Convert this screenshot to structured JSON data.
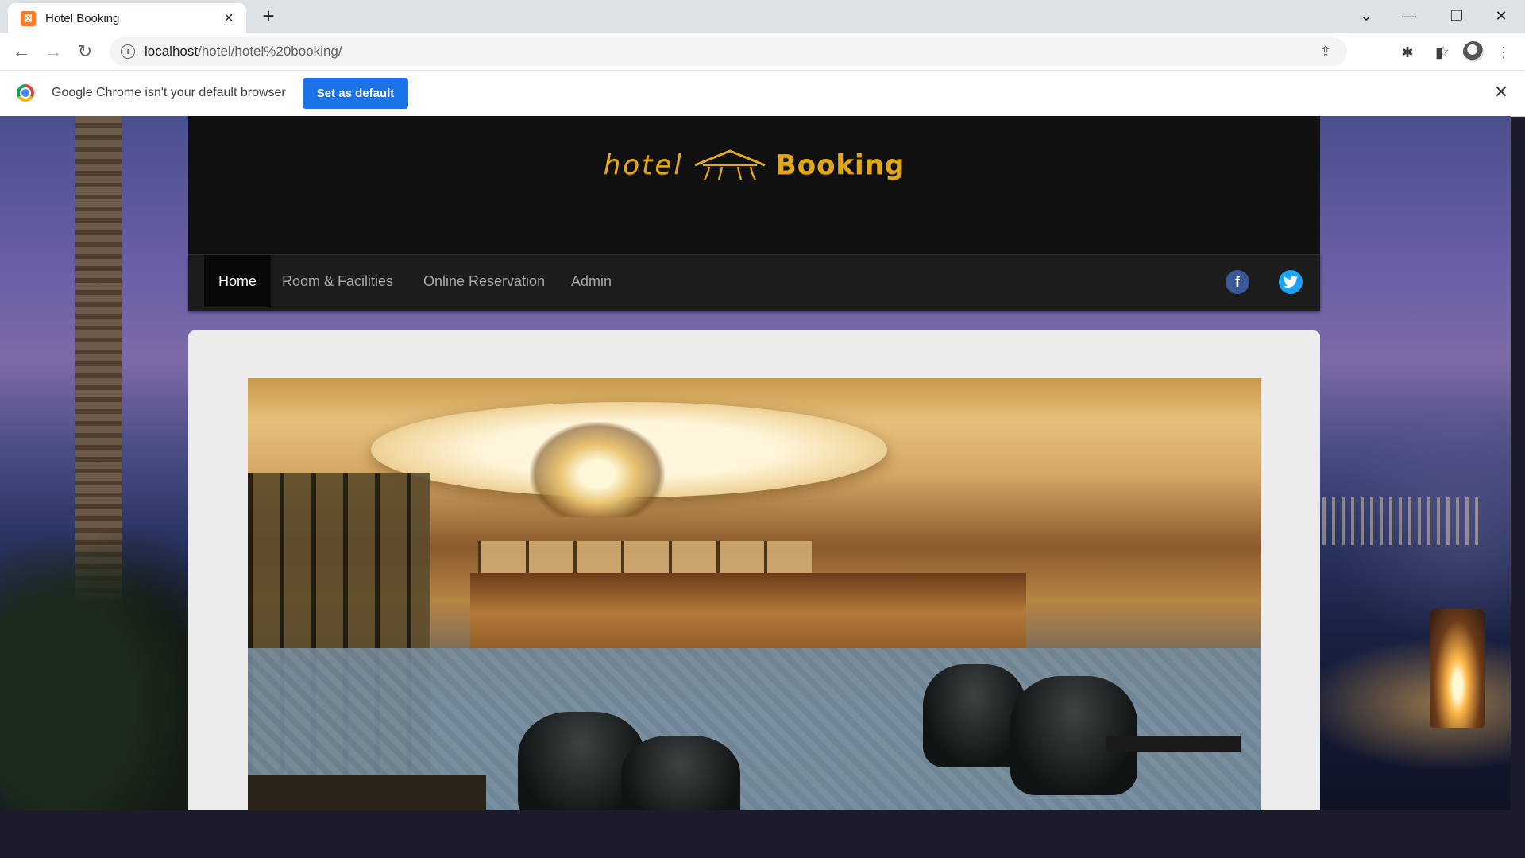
{
  "browser": {
    "tab_title": "Hotel Booking",
    "tab_favicon_letter": "⊠",
    "url_host": "localhost",
    "url_path": "/hotel/hotel%20booking/",
    "infobar_text": "Google Chrome isn't your default browser",
    "infobar_button": "Set as default"
  },
  "site": {
    "logo_left": "hotel",
    "logo_right": "Booking",
    "nav": [
      {
        "label": "Home",
        "active": true
      },
      {
        "label": "Room & Facilities",
        "active": false
      },
      {
        "label": "Online Reservation",
        "active": false
      },
      {
        "label": "Admin",
        "active": false
      }
    ],
    "social": [
      {
        "name": "facebook-icon",
        "glyph": "f",
        "color": "#3b5998"
      },
      {
        "name": "twitter-icon",
        "glyph": "t",
        "color": "#1da1f2"
      }
    ]
  },
  "colors": {
    "accent_blue": "#1a73e8",
    "logo_gold": "#e2a81c"
  }
}
